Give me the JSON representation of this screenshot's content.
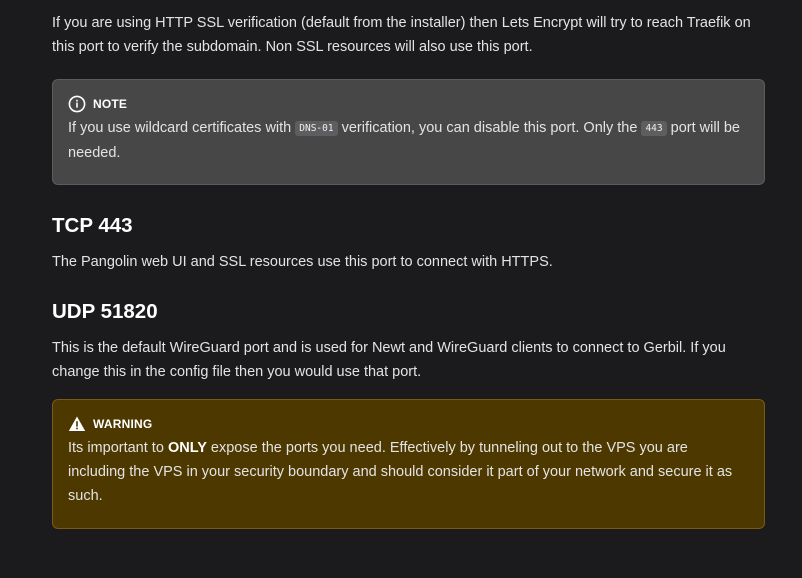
{
  "intro": {
    "text": "If you are using HTTP SSL verification (default from the installer) then Lets Encrypt will try to reach Traefik on this port to verify the subdomain. Non SSL resources will also use this port."
  },
  "note": {
    "icon": "info-circle-icon",
    "title": "NOTE",
    "text_before_code1": "If you use wildcard certificates with ",
    "code1": "DNS-01",
    "text_between": " verification, you can disable this port. Only the ",
    "code2": "443",
    "text_after": " port will be needed."
  },
  "tcp": {
    "heading": "TCP 443",
    "text": "The Pangolin web UI and SSL resources use this port to connect with HTTPS."
  },
  "udp": {
    "heading": "UDP 51820",
    "text": "This is the default WireGuard port and is used for Newt and WireGuard clients to connect to Gerbil. If you change this in the config file then you would use that port."
  },
  "warning": {
    "icon": "warning-triangle-icon",
    "title": "WARNING",
    "text_before_strong": "Its important to ",
    "strong": "ONLY",
    "text_after_strong": " expose the ports you need. Effectively by tunneling out to the VPS you are including the VPS in your security boundary and should consider it part of your network and secure it as such."
  },
  "colors": {
    "background": "#1b1b1d",
    "note_bg": "#474748",
    "warning_bg": "#4d3800",
    "warning_border": "#7a5b14"
  }
}
